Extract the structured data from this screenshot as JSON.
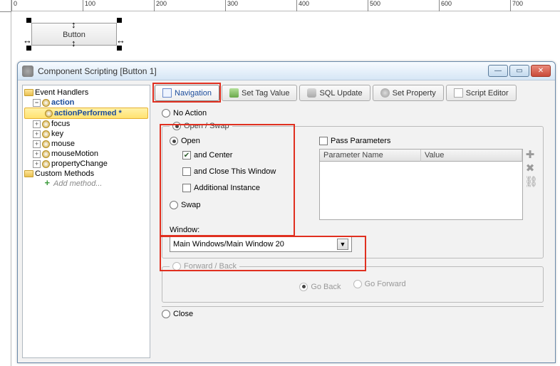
{
  "ruler_marks": [
    "0",
    "100",
    "200",
    "300",
    "400",
    "500",
    "600",
    "700"
  ],
  "design_button_label": "Button",
  "dialog": {
    "title": "Component Scripting [Button 1]"
  },
  "tree": {
    "root1": "Event Handlers",
    "action": "action",
    "actionPerformed": "actionPerformed *",
    "focus": "focus",
    "key": "key",
    "mouse": "mouse",
    "mouseMotion": "mouseMotion",
    "propertyChange": "propertyChange",
    "root2": "Custom Methods",
    "addMethod": "Add method..."
  },
  "tabs": {
    "navigation": "Navigation",
    "setTag": "Set Tag Value",
    "sql": "SQL Update",
    "setProp": "Set Property",
    "script": "Script Editor"
  },
  "nav": {
    "noAction": "No Action",
    "openSwap": "Open / Swap",
    "open": "Open",
    "andCenter": "and Center",
    "andClose": "and Close This Window",
    "additional": "Additional Instance",
    "swap": "Swap",
    "windowLabel": "Window:",
    "windowValue": "Main Windows/Main Window 20",
    "passParams": "Pass Parameters",
    "paramName": "Parameter Name",
    "paramValue": "Value",
    "fwdBack": "Forward / Back",
    "goBack": "Go Back",
    "goForward": "Go Forward",
    "close": "Close"
  }
}
